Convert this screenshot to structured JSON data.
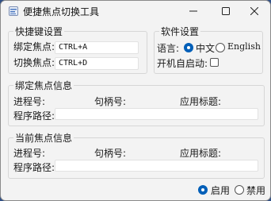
{
  "window": {
    "title": "便捷焦点切换工具"
  },
  "shortcuts": {
    "legend": "快捷键设置",
    "bind_label": "绑定焦点:",
    "bind_value": "CTRL+A",
    "switch_label": "切换焦点:",
    "switch_value": "CTRL+D"
  },
  "settings": {
    "legend": "软件设置",
    "language_label": "语言:",
    "lang_chinese": "中文",
    "lang_english": "English",
    "language_selected": "中文",
    "autostart_label": "开机自启动:",
    "autostart_checked": false
  },
  "bound": {
    "legend": "绑定焦点信息",
    "pid_label": "进程号:",
    "handle_label": "句柄号:",
    "apptitle_label": "应用标题:",
    "path_label": "程序路径:",
    "path_value": ""
  },
  "current": {
    "legend": "当前焦点信息",
    "pid_label": "进程号:",
    "handle_label": "句柄号:",
    "apptitle_label": "应用标题:",
    "path_label": "程序路径:",
    "path_value": ""
  },
  "footer": {
    "enable_label": "启用",
    "disable_label": "禁用",
    "selected": "启用"
  },
  "colors": {
    "accent": "#005fb8",
    "desktop": "#2f4f86"
  },
  "icons": {
    "app": "app-icon",
    "minimize": "minimize-icon",
    "maximize": "maximize-icon",
    "close": "close-icon"
  }
}
